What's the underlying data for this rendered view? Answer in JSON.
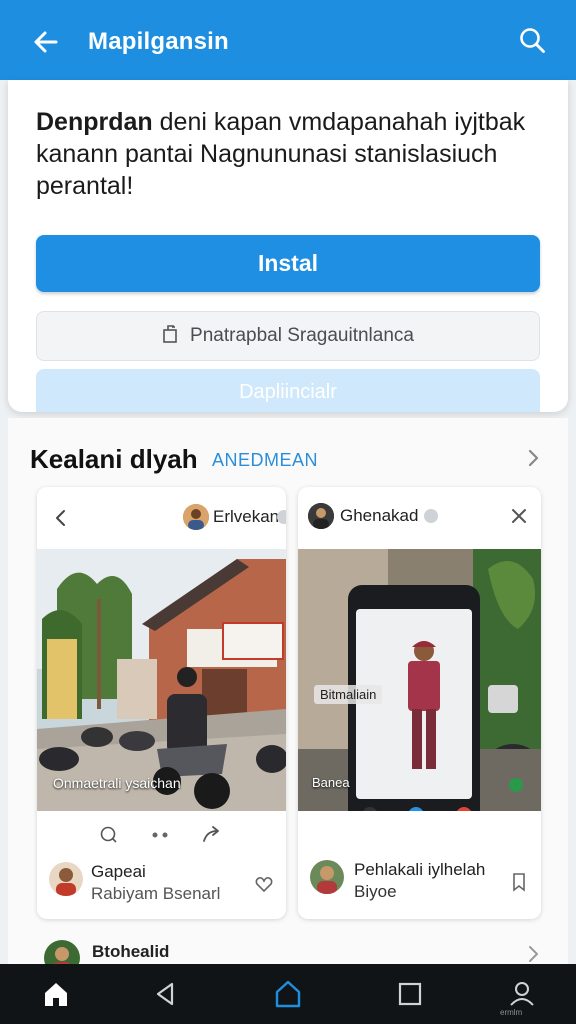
{
  "appbar": {
    "title": "Mapilgansin",
    "back_icon": "arrow-left-icon",
    "search_icon": "search-icon",
    "color": "#1e8fe0"
  },
  "prompt": {
    "text_bold": "Denprdan",
    "text_rest": " deni kapan vmdapanahah iyjtbak kanann pantai Nagnununasi stanislasiuch perantal!",
    "install_label": "Instal",
    "secondary_label": "Pnatrapbal Sragauitnlanca",
    "secondary_icon": "copy-icon",
    "faded_label": "Dapliincialr"
  },
  "section": {
    "title": "Kealani dlyah",
    "subtitle": "ANEDMEAN",
    "chevron_icon": "chevron-right-icon"
  },
  "cards": [
    {
      "username": "Erlvekan",
      "photo_caption": "Onmaetrali ysaichan",
      "actions": [
        "comment-icon",
        "more-dots-icon",
        "share-icon"
      ],
      "footer_name": "Gapeai",
      "footer_sub": "Rabiyam Bsenarl",
      "footer_icon": "heart-icon"
    },
    {
      "username": "Ghenakad",
      "photo_label": "Bitmaliain",
      "photo_caption": "Banea",
      "footer_name": "Pehlakali iylhelah",
      "footer_sub": "Biyoe",
      "footer_icon": "bookmark-icon",
      "close_icon": "close-icon"
    }
  ],
  "next_item": {
    "name": "Btohealid"
  },
  "navbar": {
    "items": [
      "home-icon",
      "back-triangle-icon",
      "house-outline-icon",
      "square-icon",
      "profile-icon"
    ],
    "profile_label": "ermlm",
    "active_color": "#1e8fe0"
  }
}
